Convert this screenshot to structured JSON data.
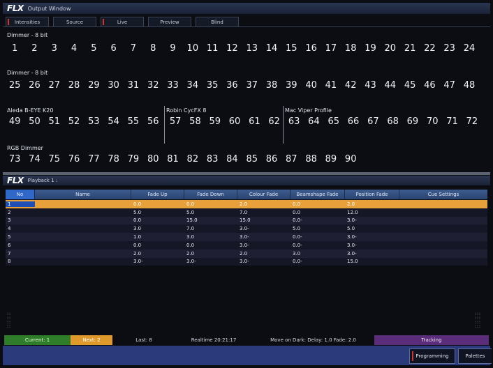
{
  "output_window": {
    "logo": "FLX",
    "title": "Output Window",
    "tabs": [
      "Intensities",
      "Source",
      "Live",
      "Preview",
      "Blind"
    ],
    "groups": [
      {
        "label": "Dimmer - 8 bit",
        "channels": [
          "1",
          "2",
          "3",
          "4",
          "5",
          "6",
          "7",
          "8",
          "9",
          "10",
          "11",
          "12",
          "13",
          "14",
          "15",
          "16",
          "17",
          "18",
          "19",
          "20",
          "21",
          "22",
          "23",
          "24"
        ]
      },
      {
        "label": "Dimmer - 8 bit",
        "channels": [
          "25",
          "26",
          "27",
          "28",
          "29",
          "30",
          "31",
          "32",
          "33",
          "34",
          "35",
          "36",
          "37",
          "38",
          "39",
          "40",
          "41",
          "42",
          "43",
          "44",
          "45",
          "46",
          "47",
          "48"
        ]
      },
      {
        "label": "Aleda B-EYE K20",
        "channels": [
          "49",
          "50",
          "51",
          "52",
          "53",
          "54",
          "55",
          "56"
        ]
      },
      {
        "label": "Robin CycFX 8",
        "channels": [
          "57",
          "58",
          "59",
          "60",
          "61",
          "62"
        ]
      },
      {
        "label": "Mac Viper Profile",
        "channels": [
          "63",
          "64",
          "65",
          "66",
          "67",
          "68",
          "69",
          "70",
          "71",
          "72"
        ]
      },
      {
        "label": "RGB Dimmer",
        "channels": [
          "73",
          "74",
          "75",
          "76",
          "77",
          "78",
          "79",
          "80",
          "81",
          "82",
          "83",
          "84",
          "85",
          "86",
          "87",
          "88",
          "89",
          "90"
        ]
      }
    ]
  },
  "playback_window": {
    "logo": "FLX",
    "title": "Playback 1 :",
    "columns": [
      "No",
      "Name",
      "Fade Up",
      "Fade Down",
      "Colour Fade",
      "Beamshape Fade",
      "Position Fade",
      "Cue Settings"
    ],
    "rows": [
      [
        "1",
        "",
        "0.0",
        "0.0",
        "2.0",
        "0.0",
        "2.0",
        ""
      ],
      [
        "2",
        "",
        "5.0",
        "5.0",
        "7.0",
        "0.0",
        "12.0",
        ""
      ],
      [
        "3",
        "",
        "0.0",
        "15.0",
        "15.0",
        "0.0-",
        "3.0-",
        ""
      ],
      [
        "4",
        "",
        "3.0",
        "7.0",
        "3.0-",
        "5.0",
        "5.0",
        ""
      ],
      [
        "5",
        "",
        "1.0",
        "3.0",
        "3.0-",
        "0.0-",
        "3.0-",
        ""
      ],
      [
        "6",
        "",
        "0.0",
        "0.0",
        "3.0-",
        "0.0-",
        "3.0-",
        ""
      ],
      [
        "7",
        "",
        "2.0",
        "2.0",
        "2.0",
        "3.0",
        "3.0-",
        ""
      ],
      [
        "8",
        "",
        "3.0-",
        "3.0-",
        "3.0-",
        "0.0-",
        "15.0",
        ""
      ]
    ],
    "selected_row": 0
  },
  "status_bar": {
    "current": "Current: 1",
    "next": "Next: 2",
    "last": "Last: 8",
    "realtime": "Realtime 20:21:17",
    "move_on_dark": "Move on Dark: Delay: 1.0  Fade: 2.0",
    "tracking": "Tracking"
  },
  "bottom_bar": {
    "programming": "Programming",
    "palettes": "Palettes"
  },
  "colors": {
    "selected_row": "#e8a13a",
    "current": "#2f7d2a",
    "next": "#e09a2c",
    "tracking": "#5b2c7a",
    "marker": "#d0372b"
  }
}
